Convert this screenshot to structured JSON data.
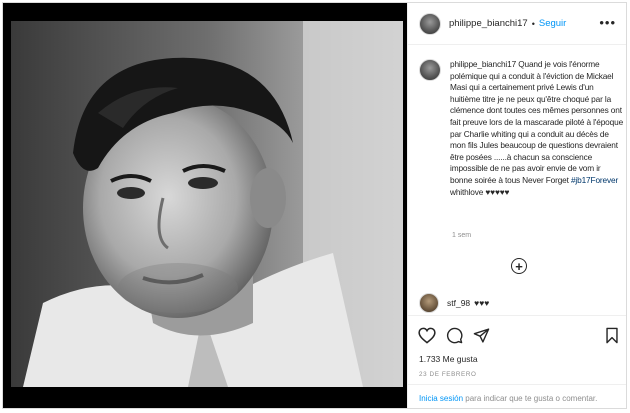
{
  "post": {
    "username": "philippe_bianchi17",
    "separator": "•",
    "follow_label": "Seguir",
    "more_label": "•••",
    "caption_pre": "Quand je vois l'énorme polémique qui a conduit à l'éviction de Mickael Masi qui a certainement privé Lewis d'un huitième titre je ne peux qu'être choqué par la clémence dont toutes ces mêmes personnes ont fait preuve lors de la mascarade piloté à l'époque par Charlie whiting qui a conduit au décès de mon fils Jules beaucoup de questions devraient être posées ......à chacun sa conscience impossible de ne pas avoir envie de vom ir bonne soirée à tous Never Forget",
    "hashtag": "#jb17Forever",
    "caption_post": "whithlove ♥♥♥♥♥",
    "time_ago": "1 sem",
    "add_comment_symbol": "+",
    "comment": {
      "username": "stf_98",
      "text": "♥♥♥"
    },
    "likes": "1.733 Me gusta",
    "date": "23 DE FEBRERO",
    "footer": {
      "login": "Inicia sesión",
      "rest": " para indicar que te gusta o comentar."
    }
  },
  "icons": [
    "heart-icon",
    "comment-icon",
    "share-icon",
    "bookmark-icon"
  ]
}
